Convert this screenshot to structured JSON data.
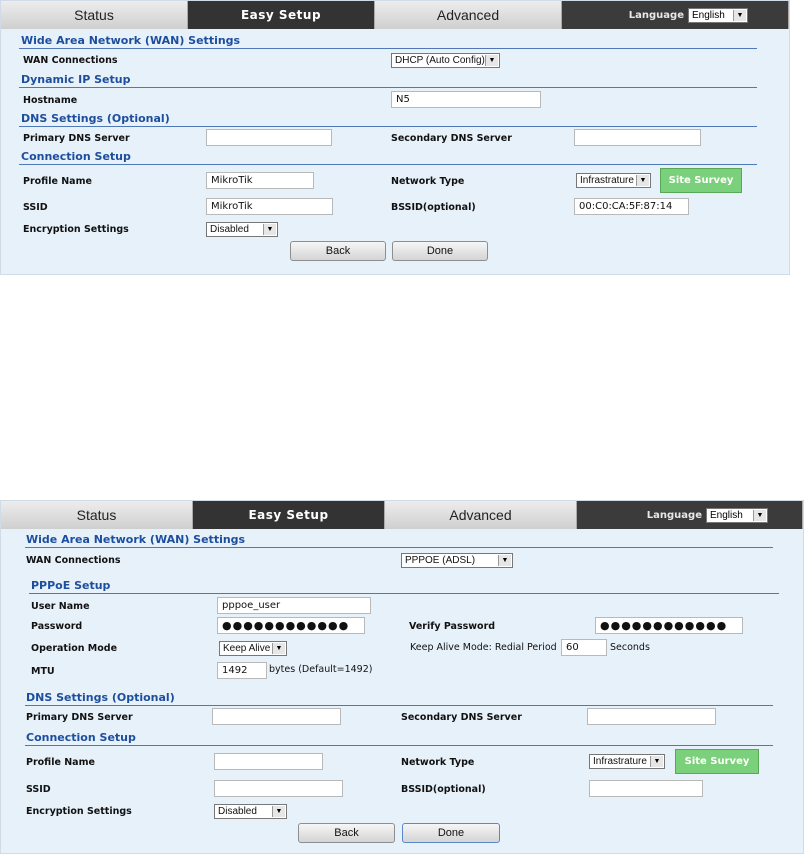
{
  "tabs": {
    "status": "Status",
    "easy_setup": "Easy Setup",
    "advanced": "Advanced",
    "language_label": "Language",
    "language_value": "English"
  },
  "screen1": {
    "wan_title": "Wide Area Network (WAN) Settings",
    "wan_connections_label": "WAN Connections",
    "wan_connections_value": "DHCP (Auto Config)",
    "dynamic_ip_title": "Dynamic IP Setup",
    "hostname_label": "Hostname",
    "hostname_value": "N5",
    "dns_title": "DNS Settings (Optional)",
    "primary_dns_label": "Primary DNS Server",
    "primary_dns_value": "",
    "secondary_dns_label": "Secondary DNS Server",
    "secondary_dns_value": "",
    "connection_title": "Connection Setup",
    "profile_name_label": "Profile Name",
    "profile_name_value": "MikroTik",
    "network_type_label": "Network Type",
    "network_type_value": "Infrastrature",
    "site_survey": "Site Survey",
    "ssid_label": "SSID",
    "ssid_value": "MikroTik",
    "bssid_label": "BSSID(optional)",
    "bssid_value": "00:C0:CA:5F:87:14",
    "encryption_label": "Encryption Settings",
    "encryption_value": "Disabled",
    "back": "Back",
    "done": "Done"
  },
  "screen2": {
    "wan_title": "Wide Area Network (WAN) Settings",
    "wan_connections_label": "WAN Connections",
    "wan_connections_value": "PPPOE (ADSL)",
    "pppoe_title": "PPPoE Setup",
    "username_label": "User Name",
    "username_value": "pppoe_user",
    "password_label": "Password",
    "password_value": "●●●●●●●●●●●●",
    "verify_password_label": "Verify Password",
    "verify_password_value": "●●●●●●●●●●●●",
    "operation_mode_label": "Operation Mode",
    "operation_mode_value": "Keep Alive",
    "keep_alive_text": "Keep Alive Mode: Redial Period",
    "redial_period_value": "60",
    "seconds_label": "Seconds",
    "mtu_label": "MTU",
    "mtu_value": "1492",
    "mtu_hint": "bytes (Default=1492)",
    "dns_title": "DNS Settings (Optional)",
    "primary_dns_label": "Primary DNS Server",
    "primary_dns_value": "",
    "secondary_dns_label": "Secondary DNS Server",
    "secondary_dns_value": "",
    "connection_title": "Connection Setup",
    "profile_name_label": "Profile Name",
    "profile_name_value": "",
    "network_type_label": "Network Type",
    "network_type_value": "Infrastrature",
    "site_survey": "Site Survey",
    "ssid_label": "SSID",
    "ssid_value": "",
    "bssid_label": "BSSID(optional)",
    "bssid_value": "",
    "encryption_label": "Encryption Settings",
    "encryption_value": "Disabled",
    "back": "Back",
    "done": "Done"
  }
}
